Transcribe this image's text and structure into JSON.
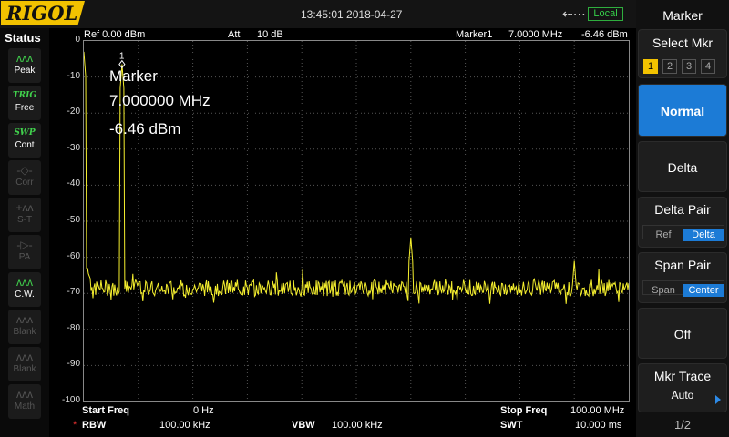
{
  "brand": "RIGOL",
  "datetime": "13:45:01 2018-04-27",
  "usb_icon": "usb-icon",
  "remote_label": "Local",
  "status": {
    "title": "Status",
    "items": [
      {
        "icon": "peak-icon",
        "glyph": "ᴧᴧᴧ",
        "label": "Peak",
        "state": "active"
      },
      {
        "icon": "trig-icon",
        "glyph": "TRIG",
        "label": "Free",
        "state": "trig"
      },
      {
        "icon": "swp-icon",
        "glyph": "SWP",
        "label": "Cont",
        "state": "trig"
      },
      {
        "icon": "corr-icon",
        "glyph": "-◇-",
        "label": "Corr",
        "state": "dim"
      },
      {
        "icon": "st-icon",
        "glyph": "+ᴧᴧ",
        "label": "S-T",
        "state": "dim"
      },
      {
        "icon": "pa-icon",
        "glyph": "-▷-",
        "label": "PA",
        "state": "dim"
      },
      {
        "icon": "cw-icon",
        "glyph": "ᴧᴧᴧ",
        "label": "C.W.",
        "state": "active"
      },
      {
        "icon": "blank1-icon",
        "glyph": "ᴧᴧᴧ",
        "label": "Blank",
        "state": "dim"
      },
      {
        "icon": "blank2-icon",
        "glyph": "ᴧᴧᴧ",
        "label": "Blank",
        "state": "dim"
      },
      {
        "icon": "math-icon",
        "glyph": "ᴧᴧᴧ",
        "label": "Math",
        "state": "dim"
      }
    ]
  },
  "header": {
    "ref": "Ref  0.00 dBm",
    "att_label": "Att",
    "att_value": "10 dB",
    "marker_label": "Marker1",
    "marker_freq": "7.0000 MHz",
    "marker_level": "-6.46 dBm"
  },
  "marker_readout": {
    "title": "Marker",
    "freq": "7.000000 MHz",
    "level": "-6.46 dBm",
    "number": "1"
  },
  "footer": {
    "start_label": "Start Freq",
    "start_value": "0 Hz",
    "stop_label": "Stop Freq",
    "stop_value": "100.00 MHz",
    "rbw_star": "*",
    "rbw_label": "RBW",
    "rbw_value": "100.00 kHz",
    "vbw_label": "VBW",
    "vbw_value": "100.00 kHz",
    "swt_label": "SWT",
    "swt_value": "10.000 ms"
  },
  "chart_data": {
    "type": "line",
    "title": "",
    "xlabel": "",
    "ylabel": "",
    "x_unit": "MHz",
    "y_unit": "dBm",
    "xlim": [
      0,
      100
    ],
    "ylim": [
      -100,
      0
    ],
    "y_ticks": [
      "0",
      "-10",
      "-20",
      "-30",
      "-40",
      "-50",
      "-60",
      "-70",
      "-80",
      "-90",
      "-100"
    ],
    "grid": true,
    "noise_floor": -68.5,
    "peaks": [
      {
        "x": 0.0,
        "y": -3
      },
      {
        "x": 0.7,
        "y": -63
      },
      {
        "x": 7.0,
        "y": -6.46
      },
      {
        "x": 60.0,
        "y": -54.5
      },
      {
        "x": 90.0,
        "y": -61
      }
    ],
    "marker": {
      "x": 7.0,
      "y": -6.46,
      "label": "1"
    },
    "trace_color": "#f5ef2e"
  },
  "menu": {
    "title": "Marker",
    "select_label": "Select Mkr",
    "markers": [
      "1",
      "2",
      "3",
      "4"
    ],
    "active_marker": "1",
    "normal": "Normal",
    "delta": "Delta",
    "delta_pair": "Delta Pair",
    "delta_pair_opts": [
      "Ref",
      "Delta"
    ],
    "span_pair": "Span Pair",
    "span_pair_opts": [
      "Span",
      "Center"
    ],
    "off": "Off",
    "mkr_trace": "Mkr Trace",
    "mkr_trace_value": "Auto",
    "page": "1/2"
  }
}
